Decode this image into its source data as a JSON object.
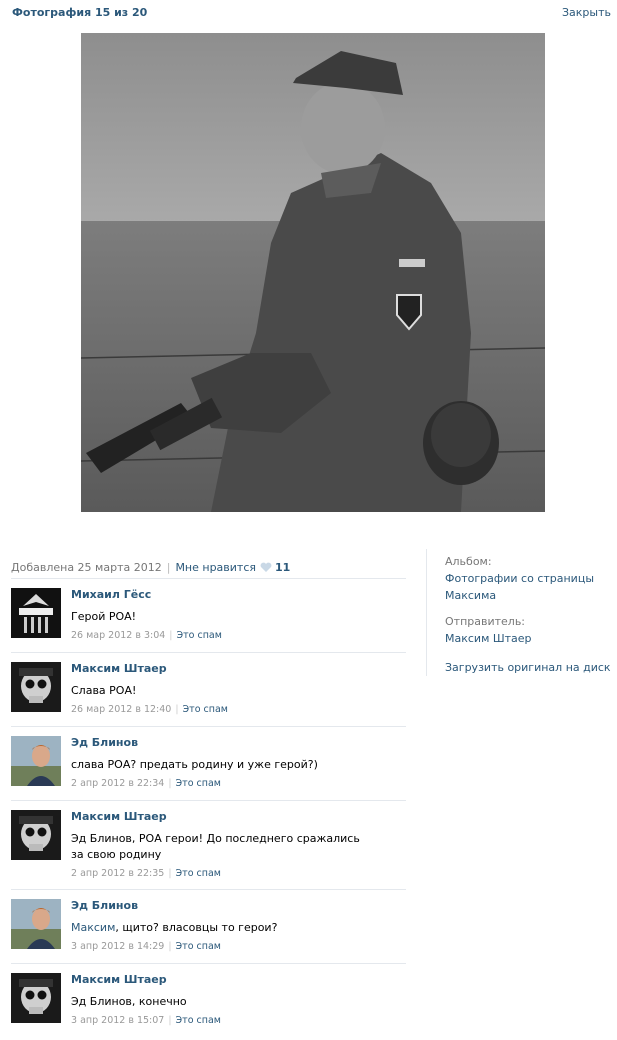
{
  "header": {
    "title": "Фотография 15 из 20",
    "close_label": "Закрыть"
  },
  "meta": {
    "added": "Добавлена 25 марта 2012",
    "like_label": "Мне нравится",
    "like_count": "11"
  },
  "sidebar": {
    "album_label": "Альбом:",
    "album_link": "Фотографии со страницы Максима",
    "sender_label": "Отправитель:",
    "sender_name": "Максим Штаер",
    "download_label": "Загрузить оригинал на диск"
  },
  "comments": [
    {
      "author": "Михаил Гёсс",
      "text": "Герой РОА!",
      "date": "26 мар 2012 в 3:04",
      "spam": "Это спам",
      "avatar": "eagle-badge"
    },
    {
      "author": "Максим Штаер",
      "text": "Слава РОА!",
      "date": "26 мар 2012 в 12:40",
      "spam": "Это спам",
      "avatar": "skull"
    },
    {
      "author": "Эд Блинов",
      "text": "слава РОА? предать родину и уже герой?)",
      "date": "2 апр 2012 в 22:34",
      "spam": "Это спам",
      "avatar": "portrait"
    },
    {
      "author": "Максим Штаер",
      "text": "Эд Блинов, РОА герои! До последнего сражались за свою родину",
      "date": "2 апр 2012 в 22:35",
      "spam": "Это спам",
      "avatar": "skull"
    },
    {
      "author": "Эд Блинов",
      "mention": "Максим",
      "text": ", щито? власовцы то герои?",
      "date": "3 апр 2012 в 14:29",
      "spam": "Это спам",
      "avatar": "portrait"
    },
    {
      "author": "Максим Штаер",
      "text": "Эд Блинов, конечно",
      "date": "3 апр 2012 в 15:07",
      "spam": "Это спам",
      "avatar": "skull"
    }
  ],
  "colors": {
    "link": "#2b587a",
    "muted": "#777777",
    "divider": "#e4e8ed"
  }
}
